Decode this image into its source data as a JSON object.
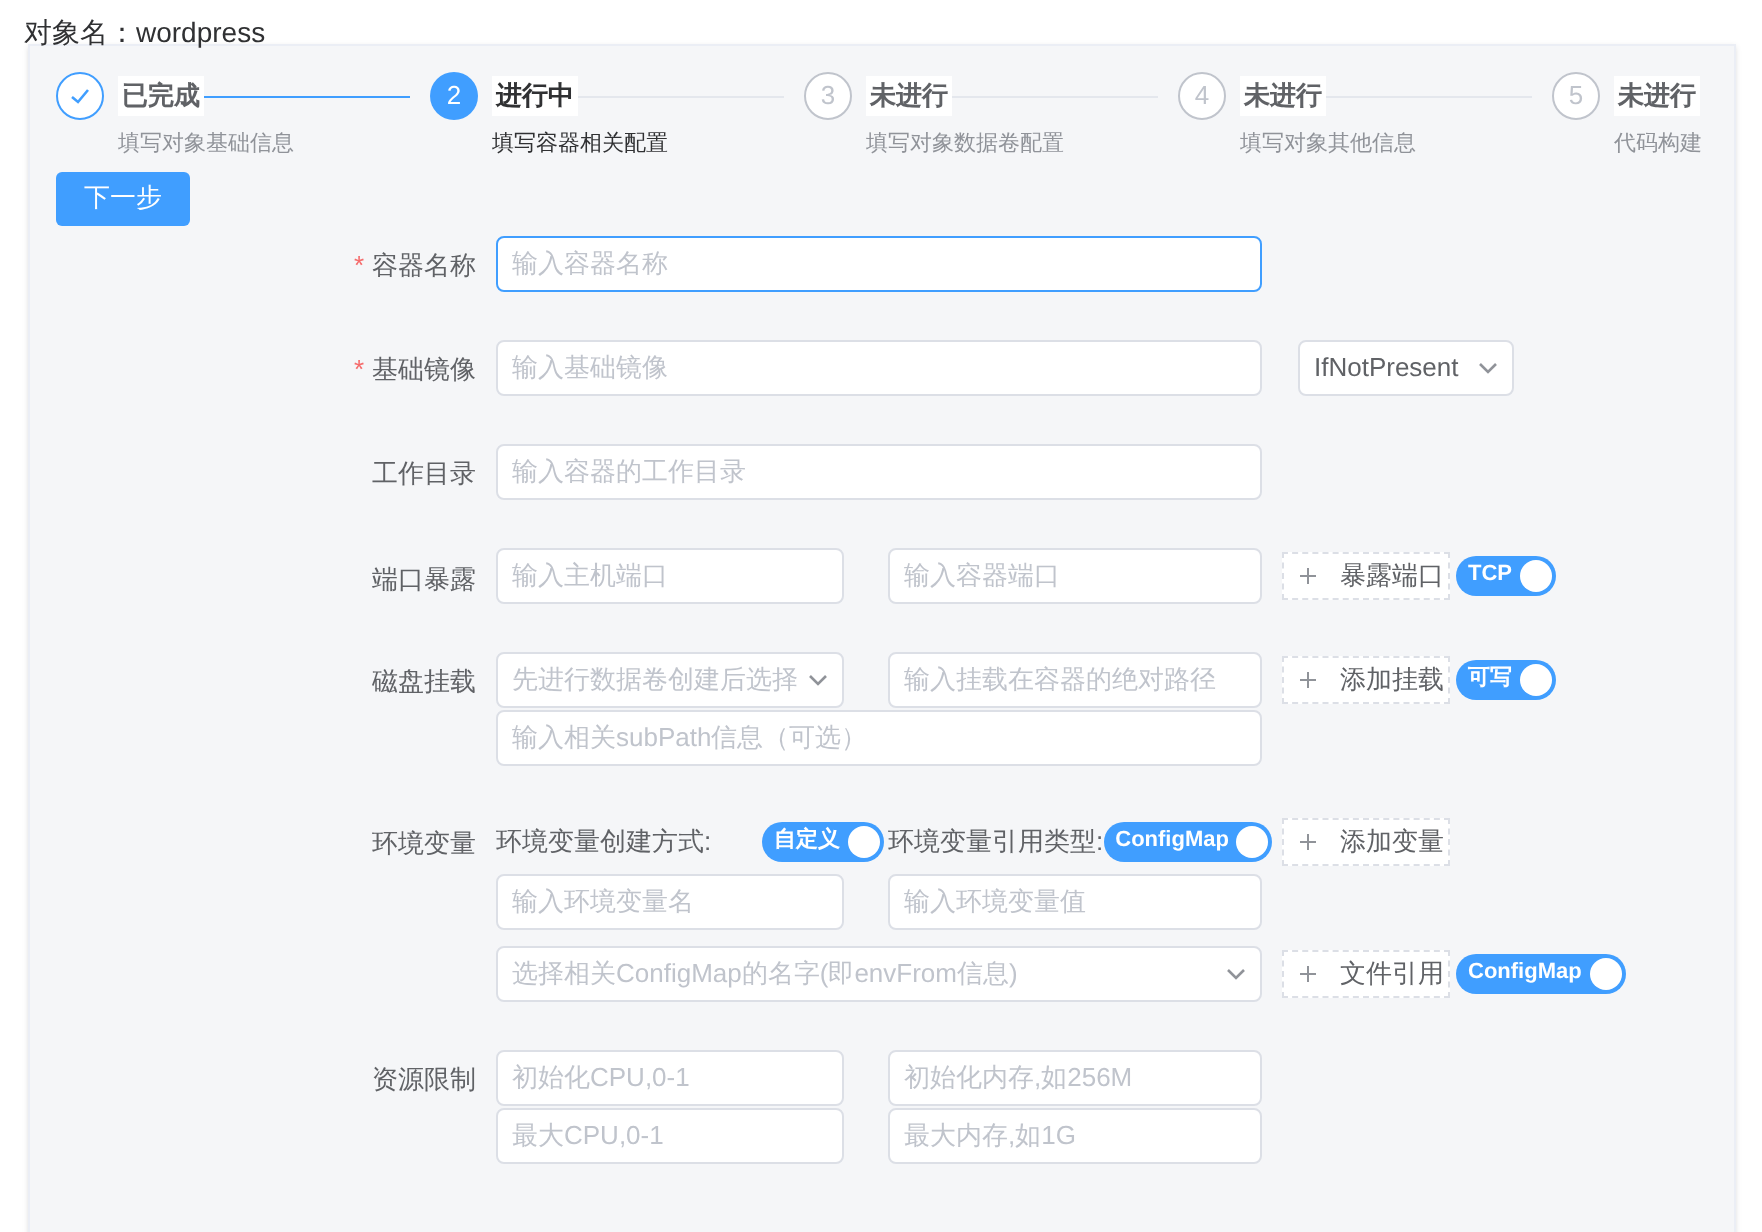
{
  "object_name": {
    "label": "对象名：",
    "value": "wordpress"
  },
  "steps": [
    {
      "kind": "done",
      "title": "已完成",
      "description": "填写对象基础信息"
    },
    {
      "kind": "active",
      "number": "2",
      "title": "进行中",
      "description": "填写容器相关配置"
    },
    {
      "kind": "pending",
      "number": "3",
      "title": "未进行",
      "description": "填写对象数据卷配置"
    },
    {
      "kind": "pending",
      "number": "4",
      "title": "未进行",
      "description": "填写对象其他信息"
    },
    {
      "kind": "pending",
      "number": "5",
      "title": "未进行",
      "description": "代码构建"
    }
  ],
  "next_button": "下一步",
  "form": {
    "container_name": {
      "label": "容器名称",
      "required_mark": "*",
      "focused": true,
      "placeholder": "输入容器名称"
    },
    "base_image": {
      "label": "基础镜像",
      "required_mark": "*",
      "placeholder": "输入基础镜像",
      "pull_policy": "IfNotPresent"
    },
    "work_dir": {
      "label": "工作目录",
      "placeholder": "输入容器的工作目录"
    },
    "ports": {
      "label": "端口暴露",
      "host_placeholder": "输入主机端口",
      "container_placeholder": "输入容器端口",
      "add_button": "暴露端口",
      "protocol_switch": {
        "label": "TCP",
        "on": true
      }
    },
    "volumes": {
      "label": "磁盘挂载",
      "volume_placeholder": "先进行数据卷创建后选择",
      "path_placeholder": "输入挂载在容器的绝对路径",
      "add_button": "添加挂载",
      "mode_switch": {
        "label": "可写",
        "on": true
      },
      "subpath_placeholder": "输入相关subPath信息（可选）"
    },
    "env": {
      "label": "环境变量",
      "create_mode_label": "环境变量创建方式:",
      "create_mode_switch": {
        "label": "自定义",
        "on": true
      },
      "ref_type_label": "环境变量引用类型:",
      "ref_type_switch": {
        "label": "ConfigMap",
        "on": true
      },
      "add_button": "添加变量",
      "name_placeholder": "输入环境变量名",
      "value_placeholder": "输入环境变量值",
      "configmap_placeholder": "选择相关ConfigMap的名字(即envFrom信息)",
      "file_ref_button": "文件引用",
      "file_ref_switch": {
        "label": "ConfigMap",
        "on": true
      }
    },
    "resources": {
      "label": "资源限制",
      "cpu_request_placeholder": "初始化CPU,0-1",
      "memory_request_placeholder": "初始化内存,如256M",
      "cpu_limit_placeholder": "最大CPU,0-1",
      "memory_limit_placeholder": "最大内存,如1G"
    }
  }
}
